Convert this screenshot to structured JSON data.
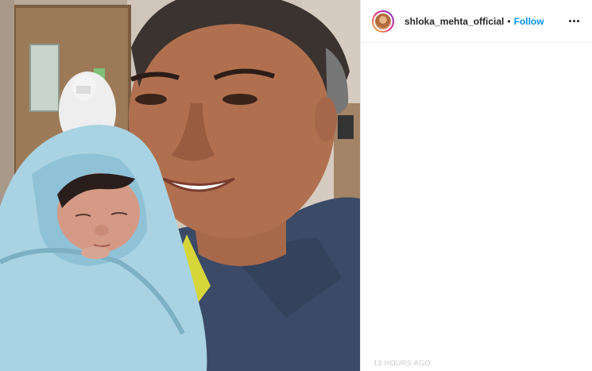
{
  "post": {
    "photo_icon": "photo-image",
    "header": {
      "avatar_icon": "profile-avatar",
      "username": "shloka_mehta_official",
      "separator": "•",
      "follow_label": "Follow",
      "more_icon": "more-options-icon"
    },
    "timestamp": "13 HOURS AGO"
  },
  "colors": {
    "follow_blue": "#0095f6",
    "text_dark": "#262626",
    "timestamp_gray": "#c7c7c7"
  }
}
